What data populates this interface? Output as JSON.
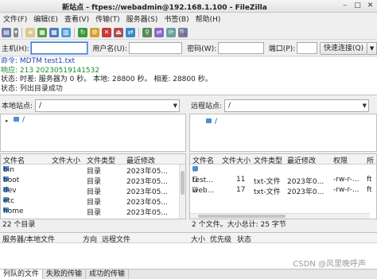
{
  "window": {
    "title": "新站点 - ftpes://webadmin@192.168.1.100 - FileZilla"
  },
  "menu": [
    "文件(F)",
    "编辑(E)",
    "查看(V)",
    "传输(T)",
    "服务器(S)",
    "书签(B)",
    "帮助(H)"
  ],
  "quickconnect": {
    "host_label": "主机(H):",
    "host_value": "",
    "user_label": "用户名(U):",
    "user_value": "",
    "pass_label": "密码(W):",
    "pass_value": "",
    "port_label": "端口(P):",
    "port_value": "",
    "connect_label": "快速连接(Q)"
  },
  "log": [
    {
      "type": "cmd",
      "text": "命令:  MDTM test1.txt"
    },
    {
      "type": "resp",
      "text": "响应:  213 20230519141532"
    },
    {
      "type": "status",
      "text": "状态:  时差: 服务器为 0 秒。 本地: 28800 秒。 相差: 28800 秒。"
    },
    {
      "type": "status",
      "text": "状态:  列出目录成功"
    }
  ],
  "local": {
    "site_label": "本地站点:",
    "site_path": "/",
    "tree_root": "/",
    "headers": [
      "文件名",
      "文件大小",
      "文件类型",
      "最近修改"
    ],
    "rows": [
      {
        "name": "bin",
        "size": "",
        "type": "目录",
        "modified": "2023年05..."
      },
      {
        "name": "boot",
        "size": "",
        "type": "目录",
        "modified": "2023年05..."
      },
      {
        "name": "dev",
        "size": "",
        "type": "目录",
        "modified": "2023年05..."
      },
      {
        "name": "etc",
        "size": "",
        "type": "目录",
        "modified": "2023年05..."
      },
      {
        "name": "home",
        "size": "",
        "type": "目录",
        "modified": "2023年05..."
      }
    ],
    "status": "22 个目录"
  },
  "remote": {
    "site_label": "远程站点:",
    "site_path": "/",
    "tree_root": "/",
    "headers": [
      "文件名",
      "文件大小",
      "文件类型",
      "最近修改",
      "权限",
      "所"
    ],
    "rows": [
      {
        "name": "..",
        "size": "",
        "type": "",
        "modified": "",
        "perm": "",
        "owner": "",
        "icon": "folder"
      },
      {
        "name": "test...",
        "size": "11",
        "type": "txt-文件",
        "modified": "2023年0...",
        "perm": "-rw-r-...",
        "owner": "ft",
        "icon": "doc"
      },
      {
        "name": "web...",
        "size": "17",
        "type": "txt-文件",
        "modified": "2023年0...",
        "perm": "-rw-r-...",
        "owner": "ft",
        "icon": "doc"
      }
    ],
    "status": "2 个文件。大小总计: 25 字节"
  },
  "queue": {
    "headers": [
      "服务器/本地文件",
      "方向",
      "远程文件",
      "大小",
      "优先级",
      "状态"
    ]
  },
  "tabs": [
    "列队的文件",
    "失败的传输",
    "成功的传输"
  ],
  "watermark": "CSDN @风里晚呼声",
  "colors": {
    "log_cmd": "#1a3fb0",
    "log_resp": "#1a8a2a",
    "folder": "#4a8fd8"
  }
}
